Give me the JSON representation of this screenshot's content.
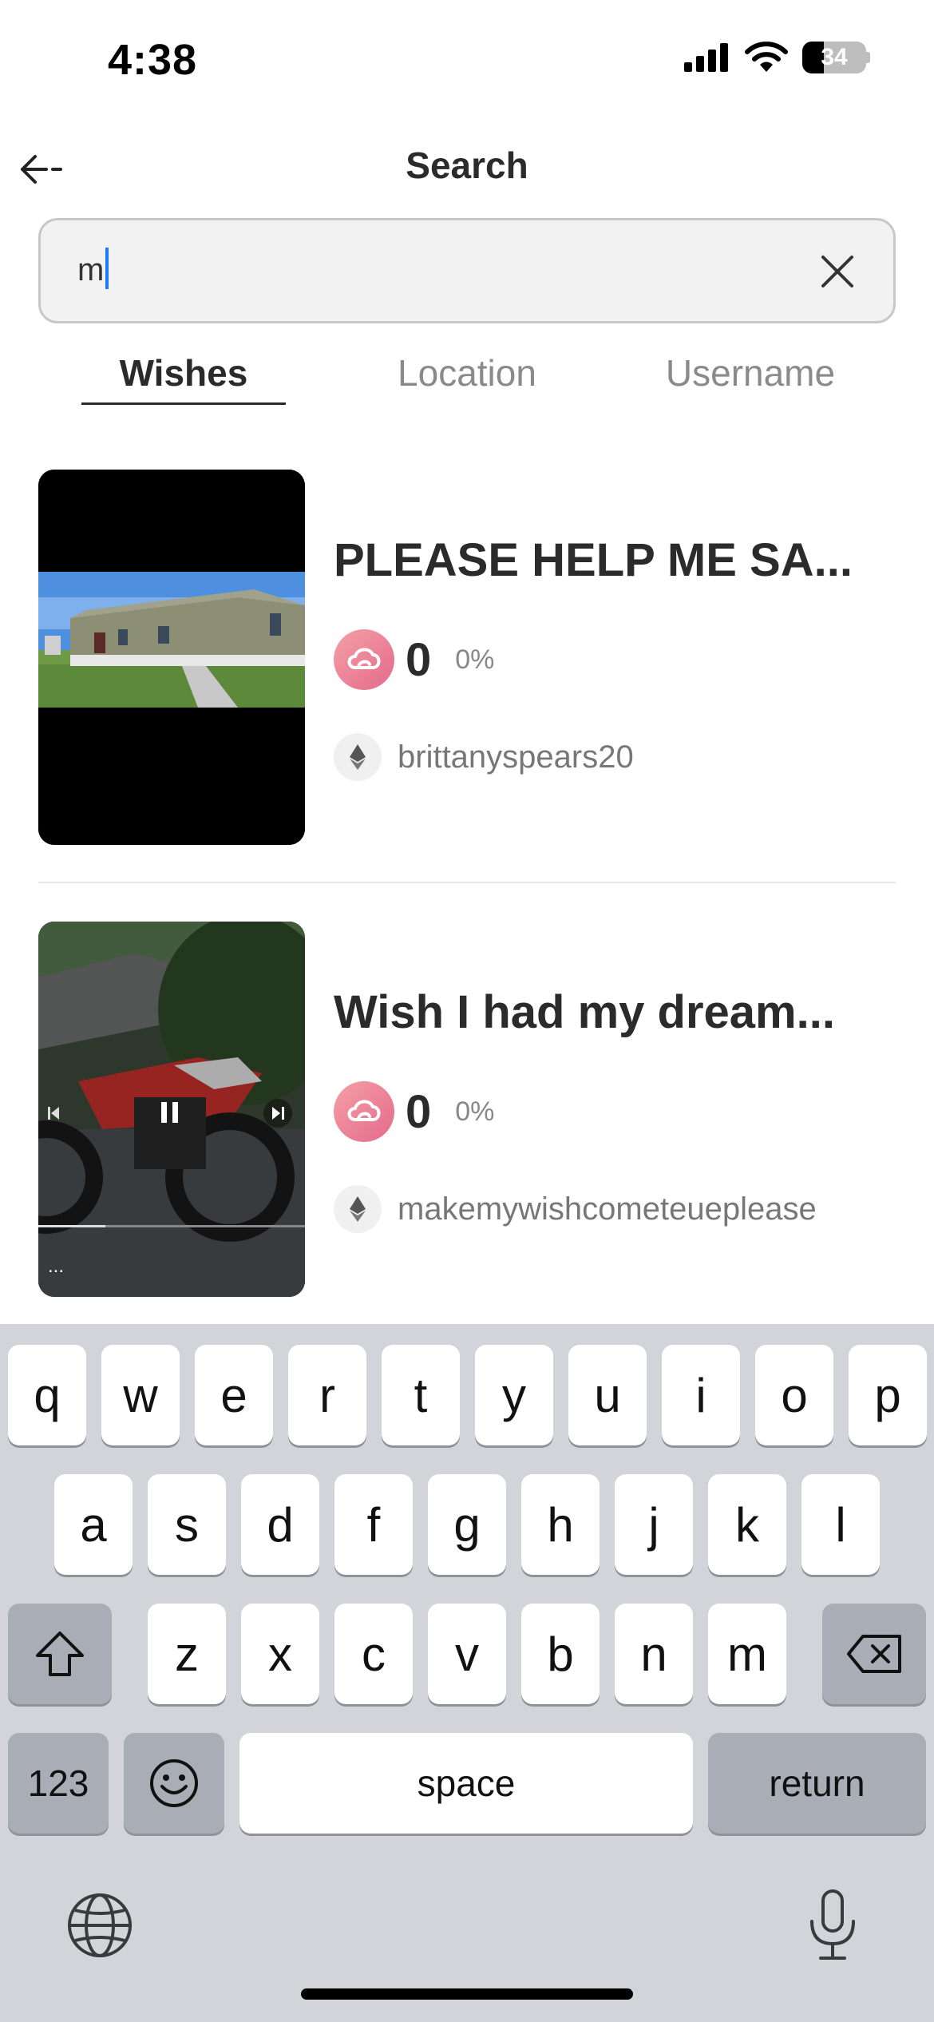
{
  "status_bar": {
    "time": "4:38",
    "battery": "34"
  },
  "header": {
    "title": "Search"
  },
  "search": {
    "value": "m"
  },
  "tabs": [
    {
      "label": "Wishes",
      "active": true
    },
    {
      "label": "Location",
      "active": false
    },
    {
      "label": "Username",
      "active": false
    }
  ],
  "results": [
    {
      "title": "PLEASE HELP ME SA...",
      "count": "0",
      "percent": "0%",
      "username": "brittanyspears20"
    },
    {
      "title": "Wish I had my dream...",
      "count": "0",
      "percent": "0%",
      "username": "makemywishcometeueplease"
    }
  ],
  "video": {
    "more_label": "..."
  },
  "keyboard": {
    "row1": [
      "q",
      "w",
      "e",
      "r",
      "t",
      "y",
      "u",
      "i",
      "o",
      "p"
    ],
    "row2": [
      "a",
      "s",
      "d",
      "f",
      "g",
      "h",
      "j",
      "k",
      "l"
    ],
    "row3": [
      "z",
      "x",
      "c",
      "v",
      "b",
      "n",
      "m"
    ],
    "numbers_label": "123",
    "space_label": "space",
    "return_label": "return"
  },
  "colors": {
    "accent": "#1e78ff",
    "wish_icon": "#e46a8a"
  }
}
